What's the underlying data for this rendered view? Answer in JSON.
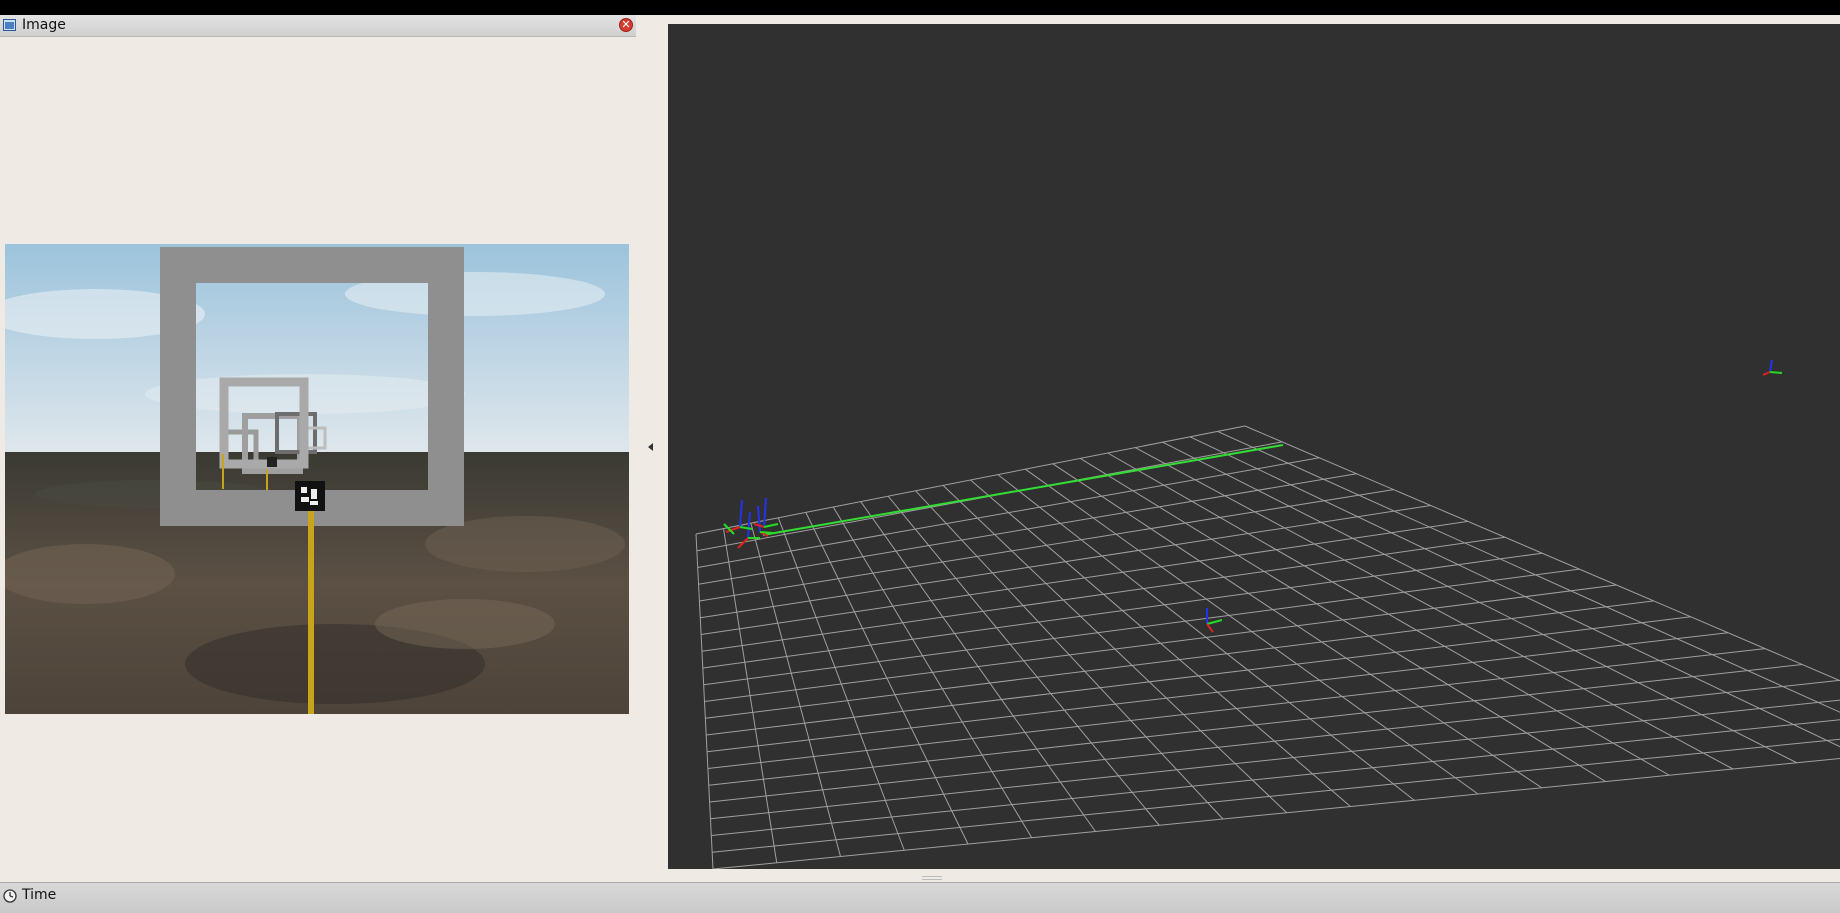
{
  "image_panel": {
    "title": "Image",
    "title_icon": "image-window-icon",
    "close_icon": "close-icon",
    "close_glyph": "✕"
  },
  "splitter": {
    "icon": "collapse-left-arrow-icon"
  },
  "viewport_3d": {
    "grid_color": "#a0a0a0",
    "background_color": "#303030",
    "path_color": "#33dd33"
  },
  "time_panel": {
    "title": "Time",
    "title_icon": "clock-icon"
  },
  "colors": {
    "panel_background": "#efebe4",
    "close_button": "#d63c2f",
    "axis_x": "#dd2222",
    "axis_y": "#22dd22",
    "axis_z": "#2233ee",
    "gate_frame": "#8f8f8f",
    "gate_post": "#c9a31a"
  }
}
